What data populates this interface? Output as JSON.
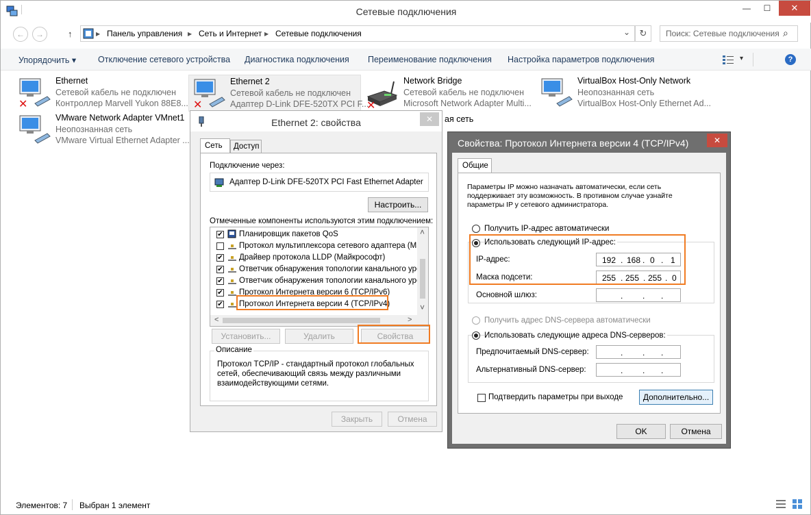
{
  "window": {
    "title": "Сетевые подключения"
  },
  "titlebar": {
    "minimize": "—",
    "maximize": "☐",
    "close": "✕"
  },
  "nav": {
    "back": "←",
    "forward": "→",
    "up": "↑",
    "breadcrumb": [
      "Панель управления",
      "Сеть и Интернет",
      "Сетевые подключения"
    ],
    "sep": "▶",
    "dropdown": "⌄",
    "refresh": "↻",
    "search_placeholder": "Поиск: Сетевые подключения",
    "search_icon": "⌕"
  },
  "cmdbar": {
    "organize": "Упорядочить ▾",
    "disable": "Отключение сетевого устройства",
    "diagnose": "Диагностика подключения",
    "rename": "Переименование подключения",
    "settings": "Настройка параметров подключения",
    "view_arrow": "▾",
    "help": "?"
  },
  "connections": [
    {
      "name": "Ethernet",
      "line2": "Сетевой кабель не подключен",
      "line3": "Контроллер Marvell Yukon 88E8..."
    },
    {
      "name": "Ethernet 2",
      "line2": "Сетевой кабель не подключен",
      "line3": "Адаптер D-Link DFE-520TX PCI F..."
    },
    {
      "name": "Network Bridge",
      "line2": "Сетевой кабель не подключен",
      "line3": "Microsoft Network Adapter Multi..."
    },
    {
      "name": "VirtualBox Host-Only Network",
      "line2": "Неопознанная сеть",
      "line3": "VirtualBox Host-Only Ethernet Ad..."
    },
    {
      "name": "VMware Network Adapter VMnet1",
      "line2": "Неопознанная сеть",
      "line3": "VMware Virtual Ethernet Adapter ..."
    }
  ],
  "hidden_fragment": "ая сеть",
  "status": {
    "count": "Элементов: 7",
    "selected": "Выбран 1 элемент"
  },
  "eth_dialog": {
    "title": "Ethernet 2: свойства",
    "close": "✕",
    "tabs": [
      "Сеть",
      "Доступ"
    ],
    "connect_via": "Подключение через:",
    "adapter": "Адаптер D-Link DFE-520TX PCI Fast Ethernet Adapter",
    "configure": "Настроить...",
    "components_label": "Отмеченные компоненты используются этим подключением:",
    "components": [
      {
        "label": "Планировщик пакетов QoS",
        "checked": "✔"
      },
      {
        "label": "Протокол мультиплексора сетевого адаптера (Май",
        "checked": ""
      },
      {
        "label": "Драйвер протокола LLDP (Майкрософт)",
        "checked": "✔"
      },
      {
        "label": "Ответчик обнаружения топологии канального уров",
        "checked": "✔"
      },
      {
        "label": "Ответчик обнаружения топологии канального уров",
        "checked": "✔"
      },
      {
        "label": "Протокол Интернета версии 6 (TCP/IPv6)",
        "checked": "✔"
      },
      {
        "label": "Протокол Интернета версии 4 (TCP/IPv4)",
        "checked": "✔"
      }
    ],
    "scroll_up": "˄",
    "scroll_down": "˅",
    "scroll_left": "<",
    "scroll_right": ">",
    "install": "Установить...",
    "remove": "Удалить",
    "properties": "Свойства",
    "description_title": "Описание",
    "description": "Протокол TCP/IP - стандартный протокол глобальных сетей, обеспечивающий связь между различными взаимодействующими сетями.",
    "close_btn": "Закрыть",
    "cancel": "Отмена"
  },
  "ipv4_dialog": {
    "title": "Свойства: Протокол Интернета версии 4 (TCP/IPv4)",
    "close": "✕",
    "tab": "Общие",
    "intro": "Параметры IP можно назначать автоматически, если сеть поддерживает эту возможность. В противном случае узнайте параметры IP у сетевого администратора.",
    "auto_ip": "Получить IP-адрес автоматически",
    "manual_ip": "Использовать следующий IP-адрес:",
    "ip_label": "IP-адрес:",
    "ip": [
      "192",
      "168",
      "0",
      "1"
    ],
    "mask_label": "Маска подсети:",
    "mask": [
      "255",
      "255",
      "255",
      "0"
    ],
    "gateway_label": "Основной шлюз:",
    "dot": ".",
    "auto_dns": "Получить адрес DNS-сервера автоматически",
    "manual_dns": "Использовать следующие адреса DNS-серверов:",
    "pref_dns": "Предпочитаемый DNS-сервер:",
    "alt_dns": "Альтернативный DNS-сервер:",
    "validate": "Подтвердить параметры при выходе",
    "advanced": "Дополнительно...",
    "ok": "OK",
    "cancel": "Отмена"
  },
  "colors": {
    "accent": "#f07b22",
    "close": "#c74b3f",
    "link": "#1e395b"
  }
}
